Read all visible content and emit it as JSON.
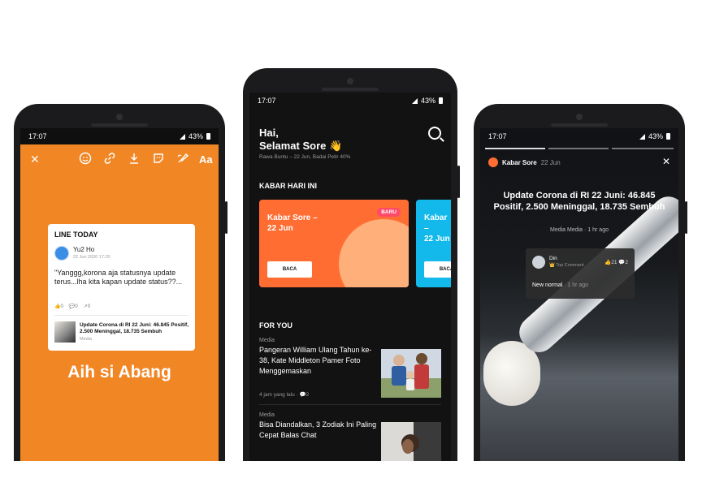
{
  "phone1": {
    "status_time": "17:07",
    "status_battery": "43%",
    "toolbar": {
      "close": "✕",
      "text_tool": "Aa"
    },
    "card": {
      "brand": "LINE TODAY",
      "user_name": "Yu2 Ho",
      "post_date": "22 Jun 2020 17:20",
      "post_text": "\"Yanggg,korona aja statusnya update terus...lha kita kapan update status??...",
      "stat_likes": "0",
      "stat_comments": "0",
      "stat_shares": "0",
      "news_title": "Update Corona di RI 22 Juni: 46.845 Positif, 2.500 Meninggal, 18.735 Sembuh",
      "news_source": "Media"
    },
    "caption": "Aih si Abang"
  },
  "phone2": {
    "status_time": "17:07",
    "status_battery": "43%",
    "greeting": "Hai,\nSelamat Sore 👋",
    "subtitle": "Rawa Buntu – 22 Jun, Badai Petir 40%",
    "section_kabar": "KABAR HARI INI",
    "kabar_cards": [
      {
        "title": "Kabar Sore –\n22 Jun",
        "badge": "BARU",
        "button": "BACA"
      },
      {
        "title": "Kabar\n–\n22 Jun",
        "button": "BACA"
      }
    ],
    "section_foryou": "FOR YOU",
    "articles": [
      {
        "category": "Media",
        "title": "Pangeran William Ulang Tahun ke-38, Kate Middleton Pamer Foto Menggemaskan",
        "time": "4 jam yang lalu",
        "comments": "2"
      },
      {
        "category": "Media",
        "title": "Bisa Diandalkan, 3 Zodiak Ini Paling Cepat Balas Chat"
      }
    ]
  },
  "phone3": {
    "status_time": "17:07",
    "status_battery": "43%",
    "channel": "Kabar Sore",
    "channel_date": "22 Jun",
    "close": "✕",
    "headline": "Update Corona di RI 22 Juni: 46.845 Positif, 2.500 Meninggal, 18.735 Sembuh",
    "source_meta": "Media Media · 1 hr ago",
    "comment": {
      "user": "Din",
      "label": "👑 Top Comment",
      "likes": "21",
      "replies": "2",
      "text": "New normal",
      "time": "1 hr ago"
    }
  },
  "colors": {
    "orange_bg": "#f18624",
    "accent_orange": "#ff6d33",
    "accent_cyan": "#12b9ea",
    "badge_pink": "#ff4a6a",
    "dark_bg": "#121212"
  }
}
